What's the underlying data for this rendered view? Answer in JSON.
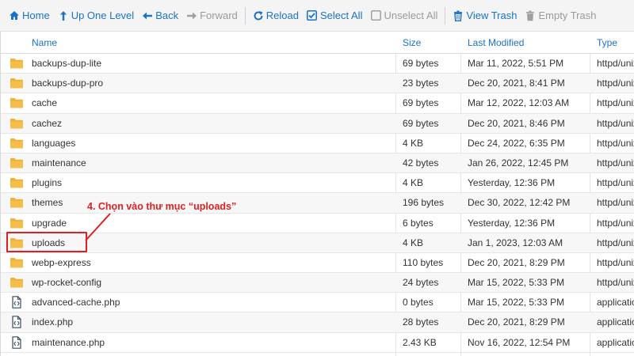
{
  "toolbar": {
    "home": "Home",
    "up_one_level": "Up One Level",
    "back": "Back",
    "forward": "Forward",
    "reload": "Reload",
    "select_all": "Select All",
    "unselect_all": "Unselect All",
    "view_trash": "View Trash",
    "empty_trash": "Empty Trash"
  },
  "table": {
    "columns": {
      "name": "Name",
      "size": "Size",
      "last_modified": "Last Modified",
      "type": "Type"
    },
    "rows": [
      {
        "name": "backups-dup-lite",
        "size": "69 bytes",
        "modified": "Mar 11, 2022, 5:51 PM",
        "type": "httpd/unix-directory",
        "icon": "folder-icon"
      },
      {
        "name": "backups-dup-pro",
        "size": "23 bytes",
        "modified": "Dec 20, 2021, 8:41 PM",
        "type": "httpd/unix-directory",
        "icon": "folder-icon"
      },
      {
        "name": "cache",
        "size": "69 bytes",
        "modified": "Mar 12, 2022, 12:03 AM",
        "type": "httpd/unix-directory",
        "icon": "folder-icon"
      },
      {
        "name": "cachez",
        "size": "69 bytes",
        "modified": "Dec 20, 2021, 8:46 PM",
        "type": "httpd/unix-directory",
        "icon": "folder-icon"
      },
      {
        "name": "languages",
        "size": "4 KB",
        "modified": "Dec 24, 2022, 6:35 PM",
        "type": "httpd/unix-directory",
        "icon": "folder-icon"
      },
      {
        "name": "maintenance",
        "size": "42 bytes",
        "modified": "Jan 26, 2022, 12:45 PM",
        "type": "httpd/unix-directory",
        "icon": "folder-icon"
      },
      {
        "name": "plugins",
        "size": "4 KB",
        "modified": "Yesterday, 12:36 PM",
        "type": "httpd/unix-directory",
        "icon": "folder-icon"
      },
      {
        "name": "themes",
        "size": "196 bytes",
        "modified": "Dec 30, 2022, 12:42 PM",
        "type": "httpd/unix-directory",
        "icon": "folder-icon"
      },
      {
        "name": "upgrade",
        "size": "6 bytes",
        "modified": "Yesterday, 12:36 PM",
        "type": "httpd/unix-directory",
        "icon": "folder-icon"
      },
      {
        "name": "uploads",
        "size": "4 KB",
        "modified": "Jan 1, 2023, 12:03 AM",
        "type": "httpd/unix-directory",
        "icon": "folder-icon"
      },
      {
        "name": "webp-express",
        "size": "110 bytes",
        "modified": "Dec 20, 2021, 8:29 PM",
        "type": "httpd/unix-directory",
        "icon": "folder-icon"
      },
      {
        "name": "wp-rocket-config",
        "size": "24 bytes",
        "modified": "Mar 15, 2022, 5:33 PM",
        "type": "httpd/unix-directory",
        "icon": "folder-icon"
      },
      {
        "name": "advanced-cache.php",
        "size": "0 bytes",
        "modified": "Mar 15, 2022, 5:33 PM",
        "type": "application/x-httpd-php",
        "icon": "php-file-icon"
      },
      {
        "name": "index.php",
        "size": "28 bytes",
        "modified": "Dec 20, 2021, 8:29 PM",
        "type": "application/x-httpd-php",
        "icon": "php-file-icon"
      },
      {
        "name": "maintenance.php",
        "size": "2.43 KB",
        "modified": "Nov 16, 2022, 12:54 PM",
        "type": "application/x-httpd-php",
        "icon": "php-file-icon"
      }
    ]
  },
  "annotation": {
    "text": "4. Chọn vào thư mục “uploads”"
  },
  "colors": {
    "link": "#1a73c8",
    "folder": "#f0b13a",
    "callout": "#e02020"
  }
}
